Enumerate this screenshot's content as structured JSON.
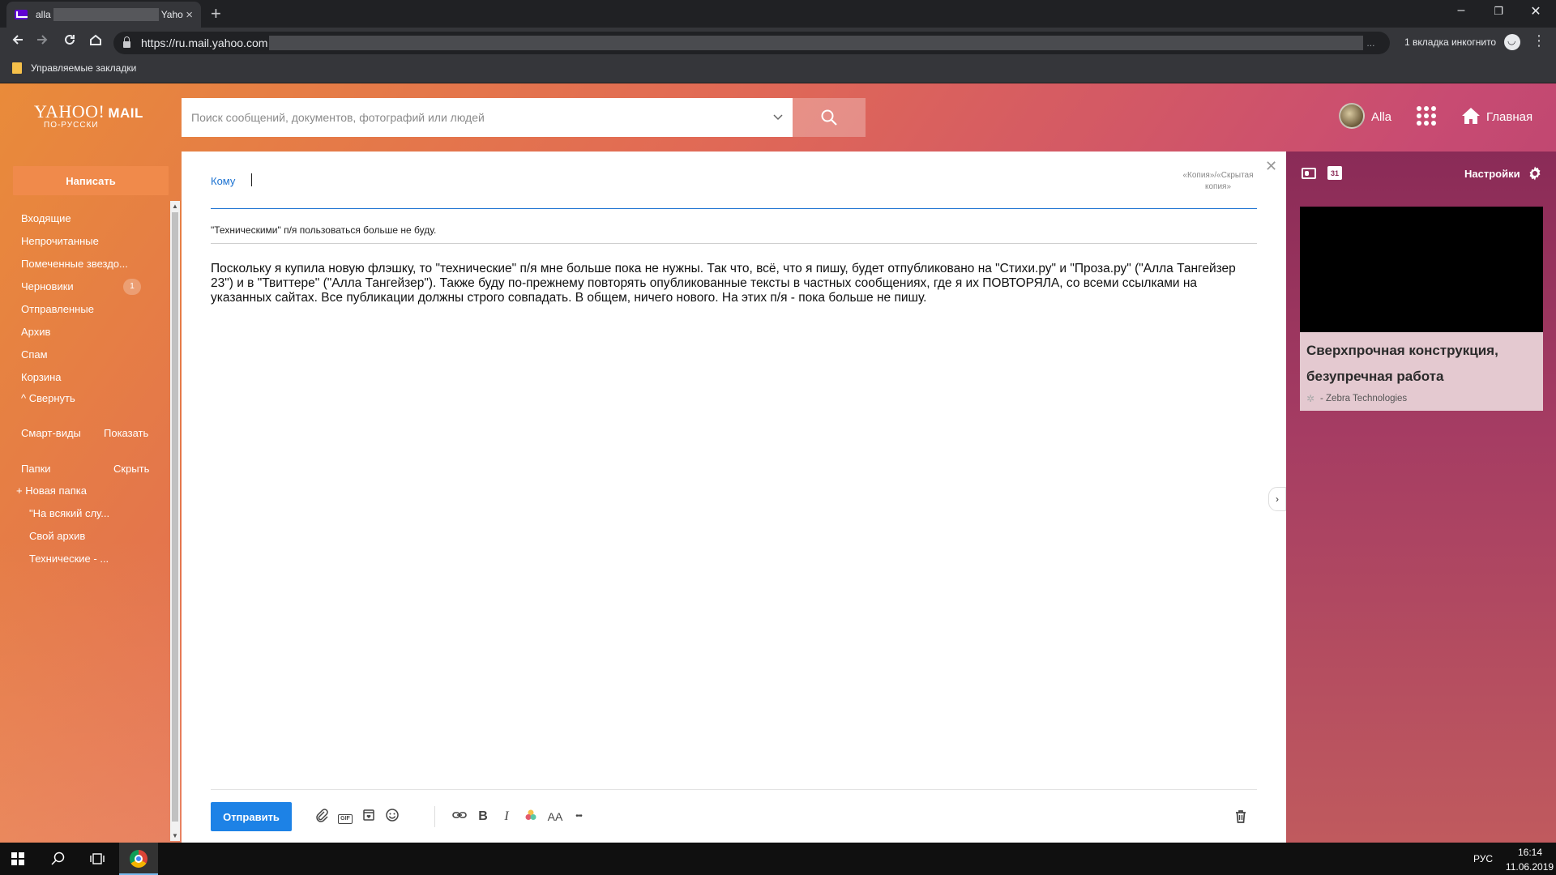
{
  "browser": {
    "tab": {
      "title_start": "alla",
      "title_end": "Yaho",
      "close": "×"
    },
    "new_tab": "+",
    "window_controls": {
      "minimize": "–",
      "restore": "❐",
      "close": "✕"
    },
    "url": "https://ru.mail.yahoo.com",
    "url_ellipsis": "...",
    "incognito_label": "1 вкладка инкогнито",
    "bookmarks_folder": "Управляемые закладки"
  },
  "header": {
    "logo_main": "YAHOO!",
    "logo_mail": "MAIL",
    "logo_sub": "ПО-РУССКИ",
    "search_placeholder": "Поиск сообщений, документов, фотографий или людей",
    "user_name": "Alla",
    "home_label": "Главная"
  },
  "sidebar": {
    "compose_label": "Написать",
    "items": [
      {
        "label": "Входящие"
      },
      {
        "label": "Непрочитанные"
      },
      {
        "label": "Помеченные звездо..."
      },
      {
        "label": "Черновики",
        "badge": "1"
      },
      {
        "label": "Отправленные"
      },
      {
        "label": "Архив"
      },
      {
        "label": "Спам"
      },
      {
        "label": "Корзина"
      },
      {
        "label": "^ Свернуть"
      }
    ],
    "smart_views": "Смарт-виды",
    "smart_views_action": "Показать",
    "folders": "Папки",
    "folders_action": "Скрыть",
    "new_folder": "+ Новая папка",
    "folder_items": [
      {
        "label": "\"На всякий слу..."
      },
      {
        "label": "Свой архив"
      },
      {
        "label": "Технические - ..."
      }
    ]
  },
  "compose": {
    "to_label": "Кому",
    "to_value": "",
    "cc_bcc": "«Копия»/«Скрытая копия»",
    "subject": "\"Техническими\" п/я пользоваться больше не буду.",
    "body": "Поскольку я купила новую флэшку, то \"технические\" п/я мне больше пока не нужны. Так что, всё, что я пишу, будет отпубликовано на \"Стихи.ру\" и \"Проза.ру\" (\"Алла Тангейзер 23\") и в \"Твиттере\" (\"Алла Тангейзер\"). Также буду по-прежнему повторять опубликованные тексты в частных сообщениях, где я их ПОВТОРЯЛА, со всеми ссылками на указанных сайтах. Все публикации должны строго совпадать. В общем, ничего нового. На этих п/я - пока больше не пишу.",
    "send_label": "Отправить",
    "toolbar": {
      "gif": "GIF",
      "bold": "B",
      "italic": "I",
      "font_size": "AA",
      "more": "•••"
    }
  },
  "right_panel": {
    "calendar_day": "31",
    "settings_label": "Настройки",
    "ad": {
      "title": "Сверхпрочная конструкция, безупречная работа",
      "sponsor": "- Zebra Technologies"
    }
  },
  "taskbar": {
    "lang": "РУС",
    "time": "16:14",
    "date": "11.06.2019"
  },
  "colors": {
    "accent_blue": "#1d82e6",
    "compose_orange": "#f08a4b",
    "chrome_dark": "#202124"
  }
}
